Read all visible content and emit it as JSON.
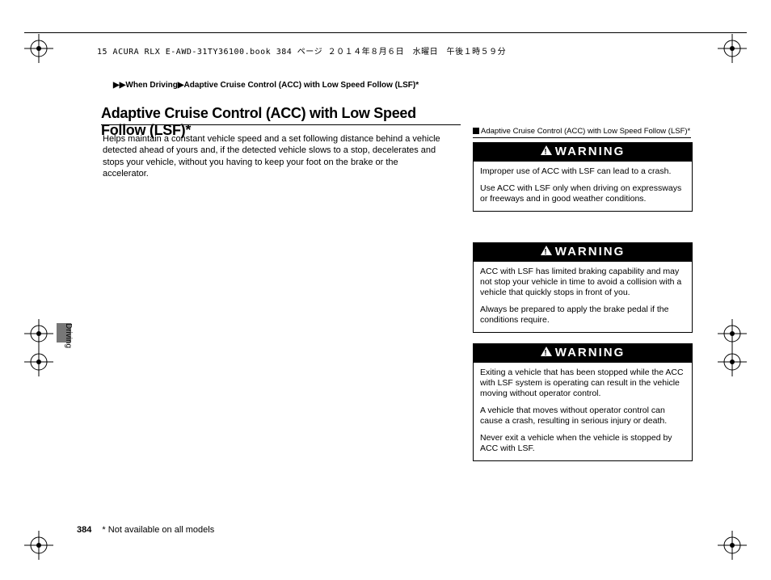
{
  "header": {
    "print_line": "15 ACURA RLX E-AWD-31TY36100.book  384 ページ  ２０１４年８月６日　水曜日　午後１時５９分"
  },
  "breadcrumb": {
    "sep": "▶▶",
    "a": "When Driving",
    "mid": "▶",
    "b": "Adaptive Cruise Control (ACC) with Low Speed Follow (LSF)",
    "star": "*"
  },
  "title": "Adaptive Cruise Control (ACC) with Low Speed Follow (LSF)*",
  "intro": "Helps maintain a constant vehicle speed and a set following distance behind a vehicle detected ahead of yours and, if the detected vehicle slows to a stop, decelerates and stops your vehicle, without you having to keep your foot on the brake or the accelerator.",
  "sidebar_heading": "Adaptive Cruise Control (ACC) with Low Speed Follow (LSF)*",
  "warning_label": "WARNING",
  "warnings": [
    {
      "p1": "Improper use of ACC with LSF can lead to a crash.",
      "p2": "Use ACC with LSF only when driving on expressways or freeways and in good weather conditions."
    },
    {
      "p1": "ACC with LSF has limited braking capability and may not stop your vehicle in time to avoid a collision with a vehicle that quickly stops in front of you.",
      "p2": "Always be prepared to apply the brake pedal if the conditions require."
    },
    {
      "p1": "Exiting a vehicle that has been stopped while the ACC with LSF system is operating can result in the vehicle moving without operator control.",
      "p2": "A vehicle that moves without operator control can cause a crash, resulting in serious injury or death.",
      "p3": "Never exit a vehicle when the vehicle is stopped by ACC with LSF."
    }
  ],
  "side_label": "Driving",
  "footer": {
    "page": "384",
    "note": "* Not available on all models"
  }
}
